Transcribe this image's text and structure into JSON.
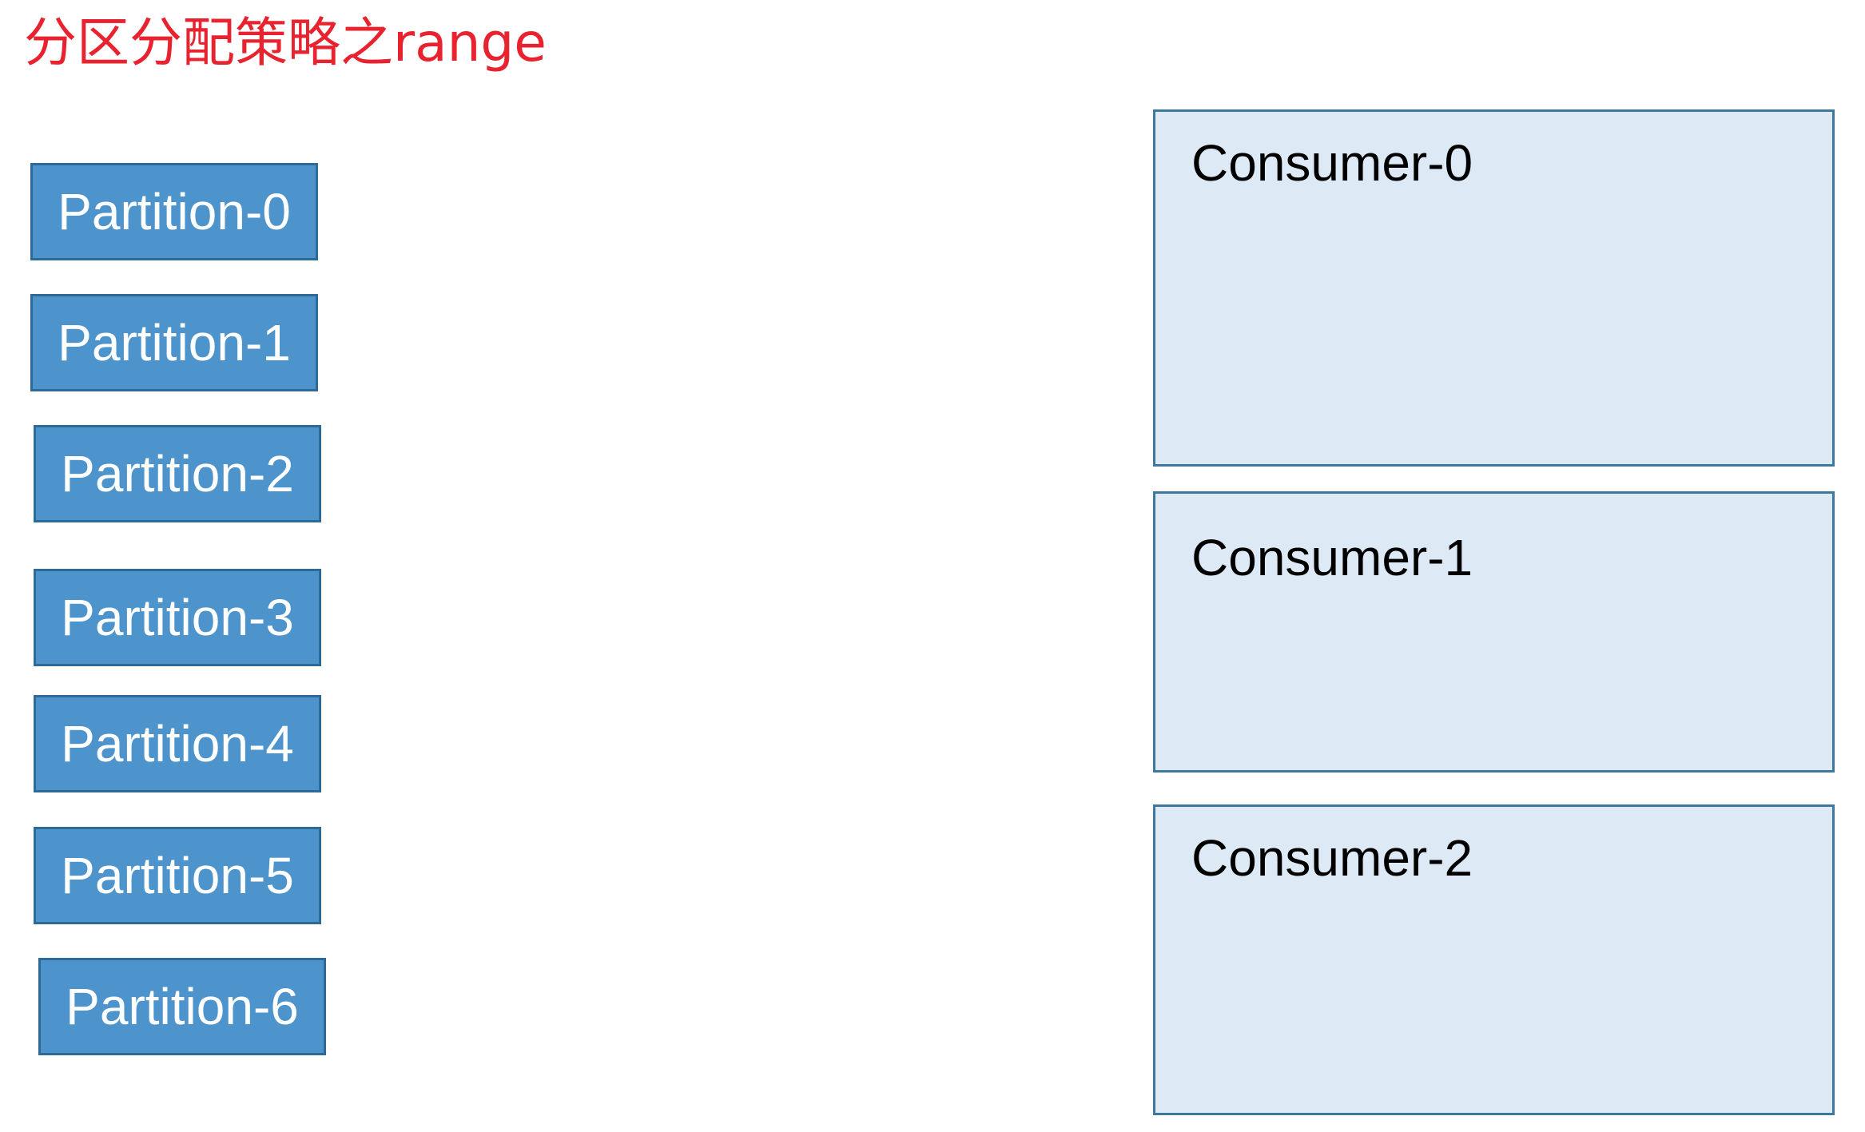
{
  "title": "分区分配策略之range",
  "colors": {
    "title": "#e8232f",
    "partition_fill": "#4d94cc",
    "partition_border": "#2f6a97",
    "partition_text": "#ffffff",
    "consumer_fill": "#ddeaf6",
    "consumer_border": "#3f789f",
    "consumer_text": "#000000"
  },
  "partitions": [
    {
      "label": "Partition-0"
    },
    {
      "label": "Partition-1"
    },
    {
      "label": "Partition-2"
    },
    {
      "label": "Partition-3"
    },
    {
      "label": "Partition-4"
    },
    {
      "label": "Partition-5"
    },
    {
      "label": "Partition-6"
    }
  ],
  "consumers": [
    {
      "label": "Consumer-0"
    },
    {
      "label": "Consumer-1"
    },
    {
      "label": "Consumer-2"
    }
  ]
}
